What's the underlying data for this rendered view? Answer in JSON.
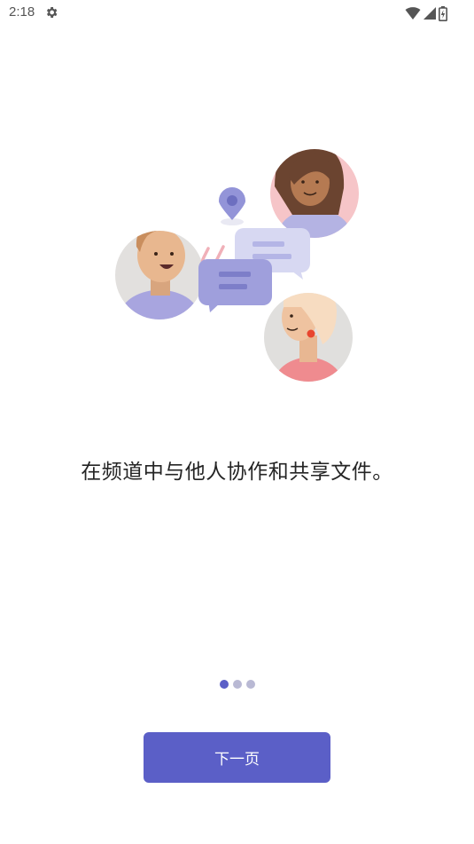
{
  "status_bar": {
    "time": "2:18",
    "icons": [
      "settings-gear-icon",
      "wifi-icon",
      "signal-icon",
      "battery-icon"
    ]
  },
  "onboarding": {
    "message": "在频道中与他人协作和共享文件。",
    "pager": {
      "total_pages": 3,
      "current_page": 1
    },
    "next_button_label": "下一页"
  },
  "colors": {
    "accent": "#5b5fc7",
    "dot_inactive": "#b9b9d4",
    "text": "#242424"
  }
}
